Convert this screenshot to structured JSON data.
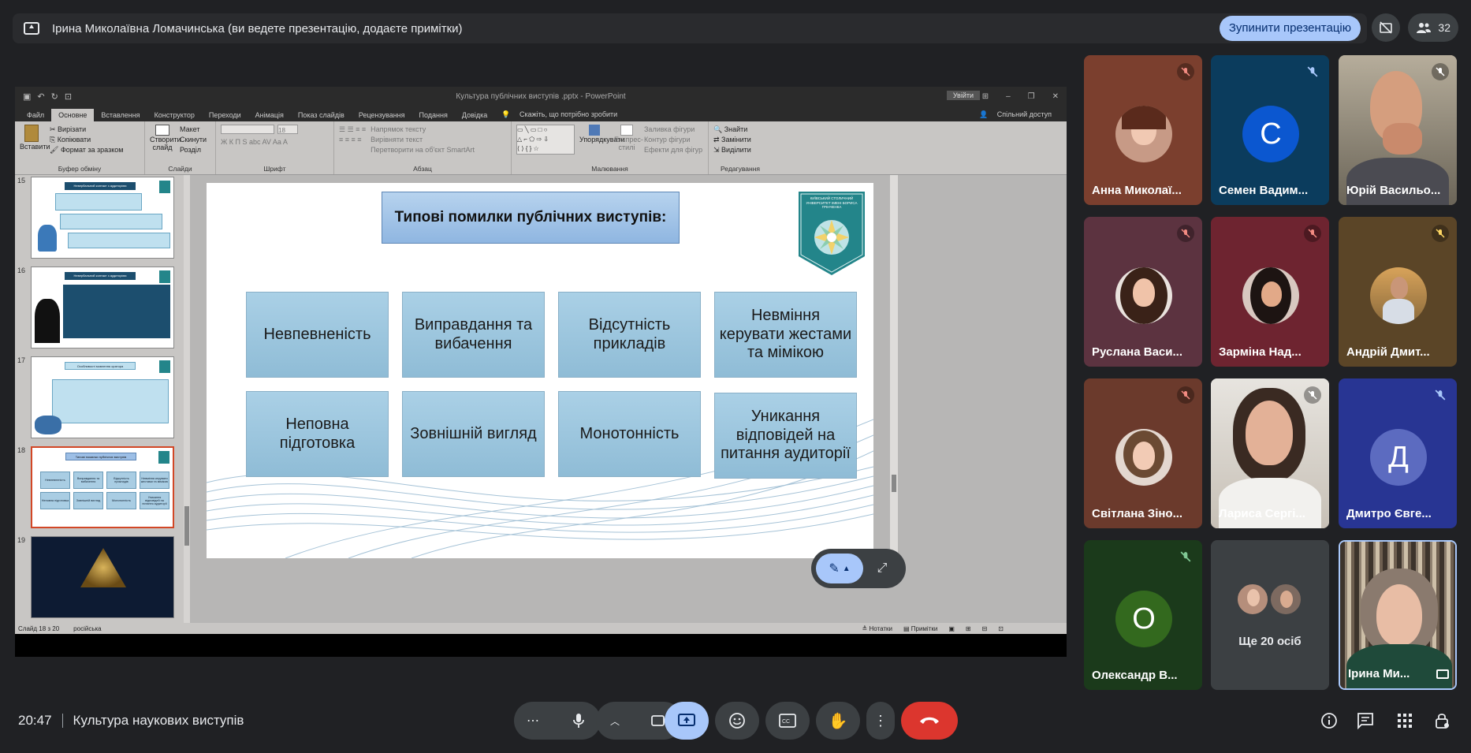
{
  "banner": {
    "text": "Ірина Миколаївна Ломачинська (ви ведете презентацію, додаєте примітки)",
    "stop_label": "Зупинити презентацію",
    "people_count": "32"
  },
  "ppt": {
    "title": "Культура публічних виступів .pptx - PowerPoint",
    "signin": "Увійти",
    "tabs": [
      "Файл",
      "Основне",
      "Вставлення",
      "Конструктор",
      "Переходи",
      "Анімація",
      "Показ слайдів",
      "Рецензування",
      "Подання",
      "Довідка"
    ],
    "tell_me": "Скажіть, що потрібно зробити",
    "share": "Спільний доступ",
    "ribbon": {
      "paste": "Вставити",
      "cut": "Вирізати",
      "copy": "Копіювати",
      "format_painter": "Формат за зразком",
      "clipboard": "Буфер обміну",
      "new_slide": "Створити слайд",
      "layout": "Макет",
      "reset": "Скинути",
      "section": "Розділ",
      "slides": "Слайди",
      "font": "Шрифт",
      "font_size": "18",
      "text_direction": "Напрямок тексту",
      "align_text": "Вирівняти текст",
      "smartart": "Перетворити на об'єкт SmartArt",
      "paragraph": "Абзац",
      "arrange": "Упорядкувати",
      "quick_styles": "Експрес-стилі",
      "shape_fill": "Заливка фігури",
      "shape_outline": "Контур фігури",
      "shape_effects": "Ефекти для фігур",
      "drawing": "Малювання",
      "find": "Знайти",
      "replace": "Замінити",
      "select": "Виділити",
      "editing": "Редагування"
    },
    "thumbs": [
      {
        "num": "15",
        "title": "Невербальний контакт з аудиторією"
      },
      {
        "num": "16",
        "title": "Невербальний контакт з аудиторією"
      },
      {
        "num": "17",
        "title": "Особливості мовлення оратора"
      },
      {
        "num": "18",
        "title": "Типові помилки публічних виступів"
      },
      {
        "num": "19",
        "title": ""
      }
    ],
    "status": {
      "slide": "Слайд 18 з 20",
      "lang": "російська",
      "notes": "Нотатки",
      "comments": "Примітки"
    }
  },
  "slide": {
    "title": "Типові помилки публічних виступів:",
    "emblem_text": "КИЇВСЬКИЙ СТОЛИЧНИЙ УНІВЕРСИТЕТ ІМЕНІ БОРИСА ГРІНЧЕНКА",
    "cells": [
      "Невпевненість",
      "Виправдання та вибачення",
      "Відсутність прикладів",
      "Невміння керувати жестами та мімікою",
      "Неповна підготовка",
      "Зовнішній вигляд",
      "Монотонність",
      "Уникання відповідей на питання аудиторії"
    ]
  },
  "participants": [
    {
      "name": "Анна Миколаї...",
      "kind": "photo"
    },
    {
      "name": "Семен Вадим...",
      "kind": "letter",
      "letter": "С",
      "color": "#0b57d0"
    },
    {
      "name": "Юрій Васильо...",
      "kind": "video"
    },
    {
      "name": "Руслана Васи...",
      "kind": "photo"
    },
    {
      "name": "Зарміна Над...",
      "kind": "photo"
    },
    {
      "name": "Андрій Дмит...",
      "kind": "photo"
    },
    {
      "name": "Світлана Зіно...",
      "kind": "photo"
    },
    {
      "name": "Лариса Сергі...",
      "kind": "video"
    },
    {
      "name": "Дмитро Євге...",
      "kind": "letter",
      "letter": "Д",
      "color": "#5c6bc0"
    },
    {
      "name": "Олександр В...",
      "kind": "letter",
      "letter": "О",
      "color": "#33691e"
    },
    {
      "name": "Ще 20 осіб",
      "kind": "more"
    },
    {
      "name": "Ірина Ми...",
      "kind": "self"
    }
  ],
  "bottom": {
    "time": "20:47",
    "meeting_title": "Культура наукових виступів"
  },
  "colors": {
    "accent": "#a8c7fa",
    "end_call": "#dc362e",
    "bg": "#202124"
  }
}
